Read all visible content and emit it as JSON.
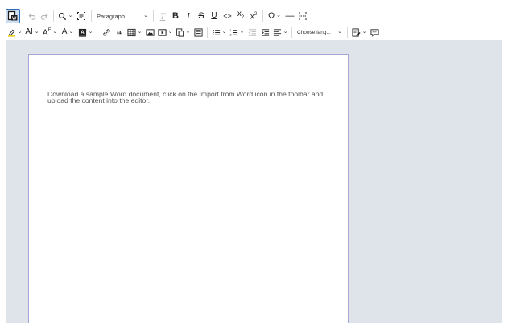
{
  "toolbar": {
    "paragraph_label": "Paragraph",
    "language_label": "Choose lang...",
    "icons": [
      "import-word-icon",
      "undo-icon",
      "redo-icon",
      "find-replace-icon",
      "select-all-icon",
      "remove-format-icon",
      "bold-icon",
      "italic-icon",
      "strikethrough-icon",
      "underline-icon",
      "code-icon",
      "subscript-icon",
      "superscript-icon",
      "special-characters-icon",
      "horizontal-line-icon",
      "page-break-icon",
      "highlight-icon",
      "font-size-icon",
      "font-family-icon",
      "font-color-icon",
      "font-background-icon",
      "link-icon",
      "blockquote-icon",
      "insert-table-icon",
      "insert-image-icon",
      "media-embed-icon",
      "insert-template-icon",
      "html-embed-icon",
      "bulleted-list-icon",
      "numbered-list-icon",
      "outdent-icon",
      "indent-icon",
      "alignment-icon",
      "track-changes-icon",
      "comment-icon"
    ]
  },
  "document": {
    "body_text": "Download a sample Word document, click on the Import from Word icon in the toolbar and upload the content into the editor."
  }
}
